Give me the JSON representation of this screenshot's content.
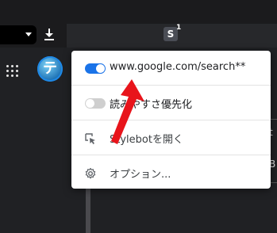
{
  "toolbar": {
    "extension_letter": "S",
    "extension_badge": "1",
    "profile_initial": "テ"
  },
  "popup": {
    "rows": [
      {
        "type": "toggle",
        "state": "on",
        "label": "www.google.com/search**"
      },
      {
        "type": "toggle",
        "state": "off",
        "label": "読みやすさ優先化"
      },
      {
        "type": "action",
        "icon": "cursor-select-icon",
        "label": "Stylebotを開く"
      },
      {
        "type": "action",
        "icon": "gear-icon",
        "label": "オプション..."
      }
    ]
  },
  "background": {
    "right_fragments": [
      "t",
      "B"
    ]
  },
  "colors": {
    "accent": "#1a73e8",
    "arrow": "#e8141b",
    "popup_bg": "#ffffff",
    "page_bg": "#202124"
  }
}
